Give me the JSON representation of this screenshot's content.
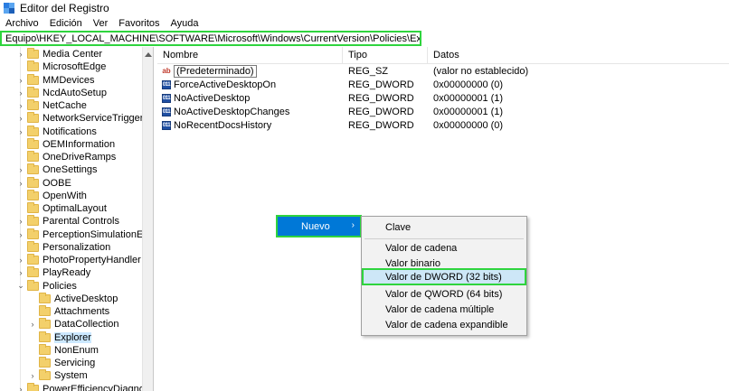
{
  "window": {
    "title": "Editor del Registro"
  },
  "menubar": [
    "Archivo",
    "Edición",
    "Ver",
    "Favoritos",
    "Ayuda"
  ],
  "address": "Equipo\\HKEY_LOCAL_MACHINE\\SOFTWARE\\Microsoft\\Windows\\CurrentVersion\\Policies\\Explorer",
  "tree": {
    "items": [
      {
        "label": "Media Center",
        "expandable": true
      },
      {
        "label": "MicrosoftEdge",
        "expandable": false
      },
      {
        "label": "MMDevices",
        "expandable": true
      },
      {
        "label": "NcdAutoSetup",
        "expandable": true
      },
      {
        "label": "NetCache",
        "expandable": true
      },
      {
        "label": "NetworkServiceTriggers",
        "expandable": true
      },
      {
        "label": "Notifications",
        "expandable": true
      },
      {
        "label": "OEMInformation",
        "expandable": false
      },
      {
        "label": "OneDriveRamps",
        "expandable": false
      },
      {
        "label": "OneSettings",
        "expandable": true
      },
      {
        "label": "OOBE",
        "expandable": true
      },
      {
        "label": "OpenWith",
        "expandable": false
      },
      {
        "label": "OptimalLayout",
        "expandable": false
      },
      {
        "label": "Parental Controls",
        "expandable": true
      },
      {
        "label": "PerceptionSimulationExter",
        "expandable": true
      },
      {
        "label": "Personalization",
        "expandable": false
      },
      {
        "label": "PhotoPropertyHandler",
        "expandable": true
      },
      {
        "label": "PlayReady",
        "expandable": true
      },
      {
        "label": "Policies",
        "expandable": true,
        "expanded": true
      },
      {
        "label": "ActiveDesktop",
        "child": true,
        "expandable": false
      },
      {
        "label": "Attachments",
        "child": true,
        "expandable": false
      },
      {
        "label": "DataCollection",
        "child": true,
        "expandable": true
      },
      {
        "label": "Explorer",
        "child": true,
        "expandable": false,
        "selected": true
      },
      {
        "label": "NonEnum",
        "child": true,
        "expandable": false
      },
      {
        "label": "Servicing",
        "child": true,
        "expandable": false
      },
      {
        "label": "System",
        "child": true,
        "expandable": true
      },
      {
        "label": "PowerEfficiencyDiagnostic",
        "expandable": true
      }
    ]
  },
  "values": {
    "headers": {
      "name": "Nombre",
      "type": "Tipo",
      "data": "Datos"
    },
    "rows": [
      {
        "icon": "string-value-icon",
        "name": "(Predeterminado)",
        "type": "REG_SZ",
        "data": "(valor no establecido)"
      },
      {
        "icon": "dword-value-icon",
        "name": "ForceActiveDesktopOn",
        "type": "REG_DWORD",
        "data": "0x00000000 (0)"
      },
      {
        "icon": "dword-value-icon",
        "name": "NoActiveDesktop",
        "type": "REG_DWORD",
        "data": "0x00000001 (1)"
      },
      {
        "icon": "dword-value-icon",
        "name": "NoActiveDesktopChanges",
        "type": "REG_DWORD",
        "data": "0x00000001 (1)"
      },
      {
        "icon": "dword-value-icon",
        "name": "NoRecentDocsHistory",
        "type": "REG_DWORD",
        "data": "0x00000000 (0)"
      }
    ]
  },
  "context_menu": {
    "item": "Nuevo",
    "submenu": [
      "Clave",
      "Valor de cadena",
      "Valor binario",
      "Valor de DWORD (32 bits)",
      "Valor de QWORD (64 bits)",
      "Valor de cadena múltiple",
      "Valor de cadena expandible"
    ],
    "highlighted": "Valor de DWORD (32 bits)"
  },
  "colors": {
    "highlight_box": "#2fd43e",
    "menu_selected": "#0078d7",
    "tree_selected": "#cce8ff"
  }
}
